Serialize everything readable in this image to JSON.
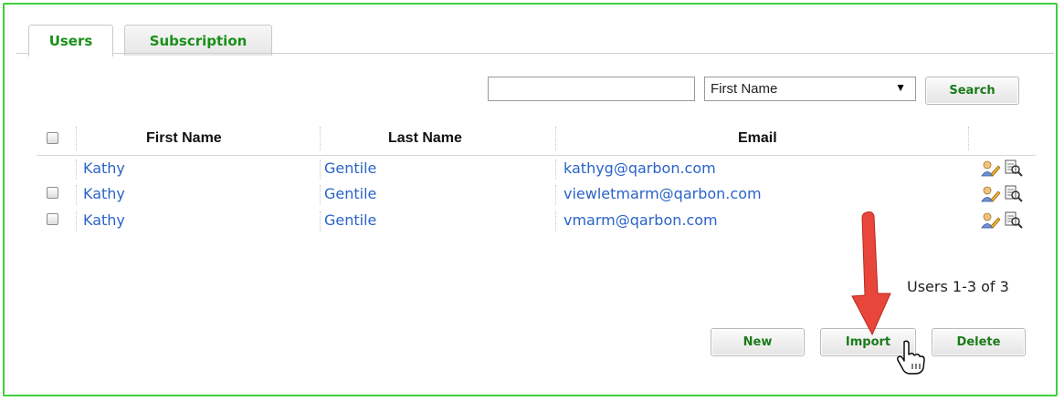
{
  "tabs": [
    {
      "label": "Users"
    },
    {
      "label": "Subscription"
    }
  ],
  "search": {
    "value": "",
    "field_selected": "First Name",
    "button_label": "Search"
  },
  "table": {
    "columns": [
      "First Name",
      "Last Name",
      "Email"
    ],
    "rows": [
      {
        "first": "Kathy",
        "last": "Gentile",
        "email": "kathyg@qarbon.com",
        "checkbox": false
      },
      {
        "first": "Kathy",
        "last": "Gentile",
        "email": "viewletmarm@qarbon.com",
        "checkbox": true
      },
      {
        "first": "Kathy",
        "last": "Gentile",
        "email": "vmarm@qarbon.com",
        "checkbox": true
      }
    ]
  },
  "pagination": {
    "text": "Users 1-3 of 3"
  },
  "actions": {
    "new_label": "New",
    "import_label": "Import",
    "delete_label": "Delete"
  },
  "colors": {
    "frame": "#3fcf3f",
    "accent_green": "#1a8f1a",
    "link_blue": "#2a63c8",
    "arrow_red": "#e8463a"
  },
  "icons": [
    "edit-user-icon",
    "view-details-icon",
    "pointer-hand-cursor-icon",
    "red-arrow-annotation"
  ]
}
